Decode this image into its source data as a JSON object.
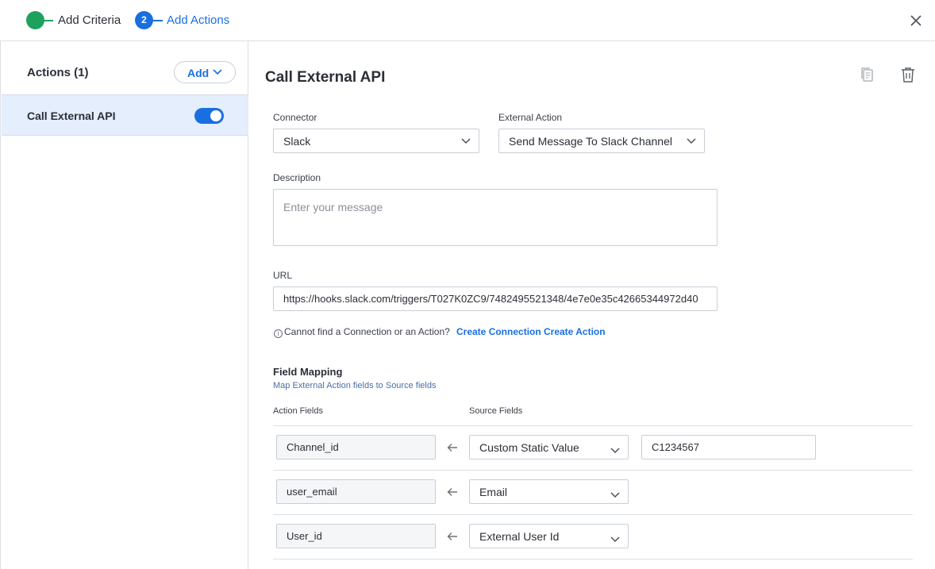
{
  "stepper": {
    "step1_label": "Add Criteria",
    "step2_number": "2",
    "step2_label": "Add Actions",
    "complete_color": "#1ea15c",
    "active_color": "#1a6fe0"
  },
  "sidebar": {
    "title": "Actions (1)",
    "add_label": "Add",
    "items": [
      {
        "label": "Call External API",
        "enabled": true
      }
    ]
  },
  "main": {
    "title": "Call External API",
    "connector": {
      "label": "Connector",
      "value": "Slack"
    },
    "external_action": {
      "label": "External Action",
      "value": "Send Message To Slack Channel"
    },
    "description": {
      "label": "Description",
      "placeholder": "Enter your message"
    },
    "url": {
      "label": "URL",
      "value": "https://hooks.slack.com/triggers/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"
    },
    "hint": {
      "info_glyph": "i",
      "text": "Cannot find a Connection or an Action?",
      "create_connection": "Create Connection",
      "create_action": "Create Action"
    },
    "field_mapping": {
      "title": "Field Mapping",
      "subtitle": "Map External Action fields to Source fields",
      "action_fields_header": "Action Fields",
      "source_fields_header": "Source Fields",
      "rows": [
        {
          "action_field": "Channel_id",
          "source_field": "Custom Static Value",
          "static_value": "C1234567"
        },
        {
          "action_field": "user_email",
          "source_field": "Email"
        },
        {
          "action_field": "User_id",
          "source_field": "External User Id"
        }
      ]
    }
  },
  "icons": {
    "close": "close-icon",
    "chevron": "chevron-down-icon",
    "copy": "copy-icon",
    "trash": "trash-icon",
    "arrow": "arrow-left-icon",
    "info": "info-icon"
  }
}
